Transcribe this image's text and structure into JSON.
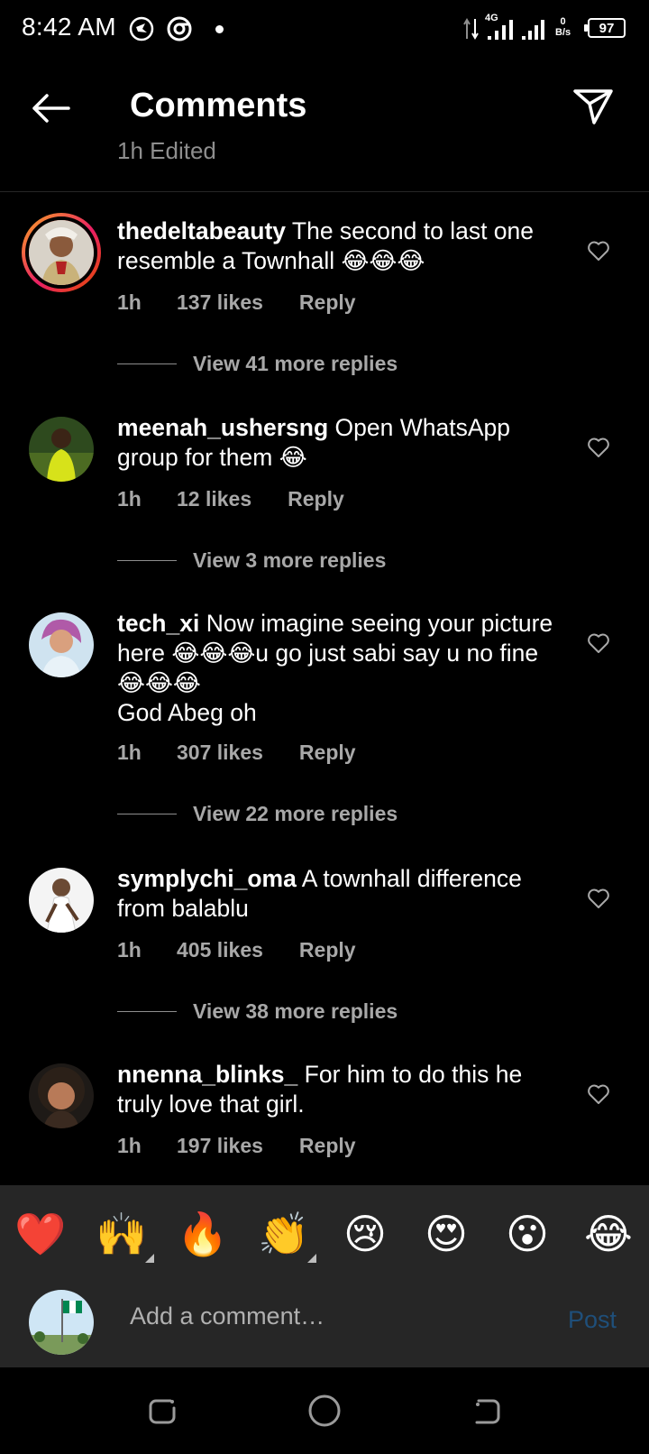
{
  "status_bar": {
    "time": "8:42 AM",
    "network": "4G",
    "speed_value": "0",
    "speed_unit": "B/s",
    "battery": "97"
  },
  "header": {
    "title": "Comments",
    "back_icon": "arrow-left-icon",
    "share_icon": "paper-plane-icon"
  },
  "edited_peek": "1h   Edited",
  "comments": [
    {
      "username": "thedeltabeauty",
      "text": " The second to last one resemble a Townhall 😂😂😂",
      "time": "1h",
      "likes": "137 likes",
      "reply": "Reply",
      "view_replies": "View 41 more replies",
      "story_ring": true
    },
    {
      "username": "meenah_ushersng",
      "text": " Open WhatsApp group for them 😂",
      "time": "1h",
      "likes": "12 likes",
      "reply": "Reply",
      "view_replies": "View 3 more replies"
    },
    {
      "username": "tech_xi",
      "text": " Now imagine seeing your picture here 😂😂😂u go just sabi say u no fine 😂😂😂\nGod Abeg oh",
      "time": "1h",
      "likes": "307 likes",
      "reply": "Reply",
      "view_replies": "View 22 more replies"
    },
    {
      "username": "symplychi_oma",
      "text": " A townhall difference from balablu",
      "time": "1h",
      "likes": "405 likes",
      "reply": "Reply",
      "view_replies": "View 38 more replies"
    },
    {
      "username": "nnenna_blinks_",
      "text": " For him to do this he truly love that girl.",
      "time": "1h",
      "likes": "197 likes",
      "reply": "Reply"
    }
  ],
  "emoji_bar": [
    "❤️",
    "🙌",
    "🔥",
    "👏",
    "😢",
    "😍",
    "😮",
    "😂"
  ],
  "composer": {
    "placeholder": "Add a comment…",
    "post_label": "Post"
  },
  "colors": {
    "background": "#000000",
    "muted_text": "#a8a8a8",
    "bar_background": "#262626",
    "post_disabled": "#1f4f7a"
  }
}
